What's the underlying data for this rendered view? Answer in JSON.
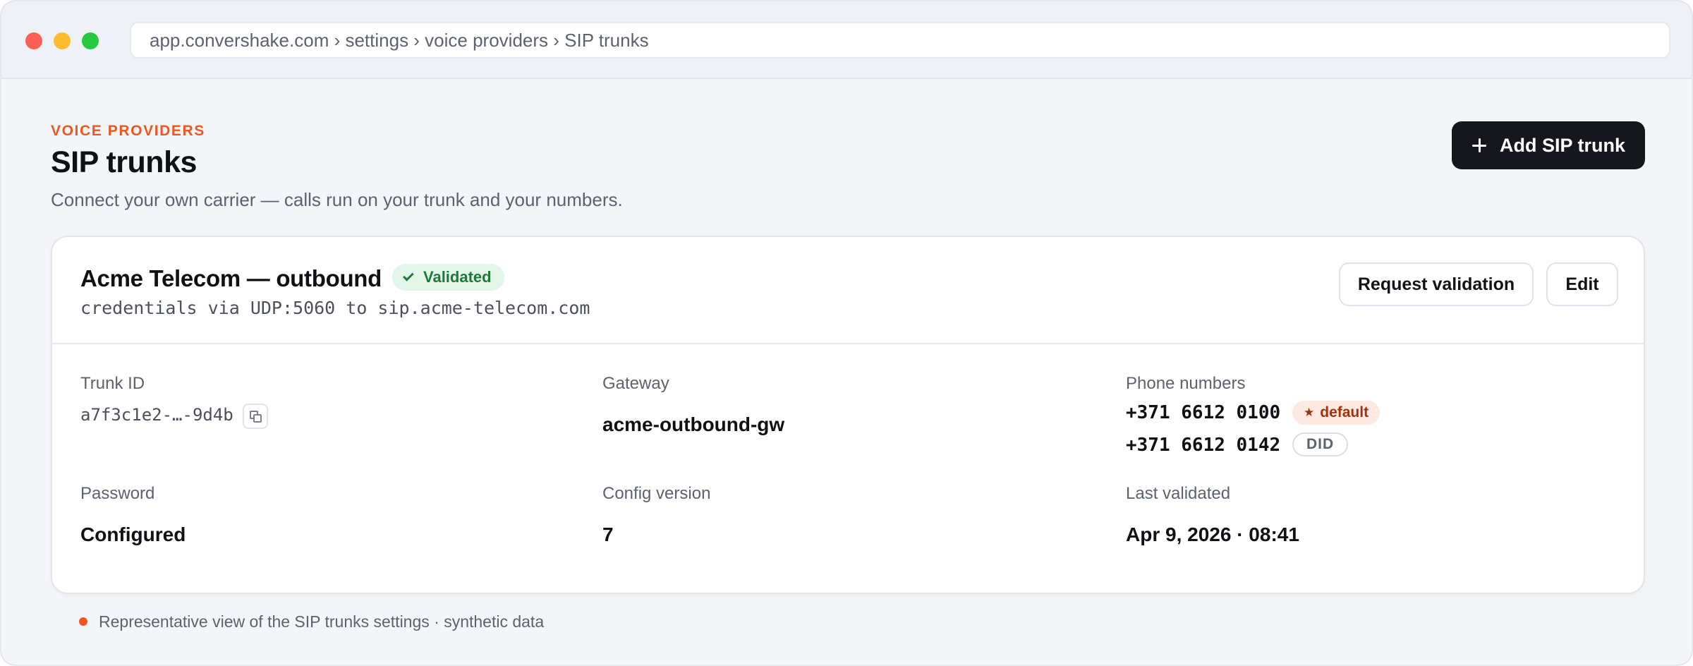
{
  "browser": {
    "address": "app.convershake.com › settings › voice providers › SIP trunks"
  },
  "header": {
    "eyebrow": "VOICE PROVIDERS",
    "title": "SIP trunks",
    "subtitle": "Connect your own carrier — calls run on your trunk and your numbers.",
    "add_button_label": "Add SIP trunk"
  },
  "trunk": {
    "name": "Acme Telecom — outbound",
    "status_badge": "Validated",
    "description": "credentials via UDP:5060 to sip.acme-telecom.com",
    "request_validation_label": "Request validation",
    "edit_label": "Edit",
    "fields": {
      "trunk_id_label": "Trunk ID",
      "trunk_id_value": "a7f3c1e2-…-9d4b",
      "gateway_label": "Gateway",
      "gateway_value": "acme-outbound-gw",
      "phone_numbers_label": "Phone numbers",
      "phone_numbers": [
        {
          "number": "+371 6612 0100",
          "badge": "default"
        },
        {
          "number": "+371 6612 0142",
          "badge": "DID"
        }
      ],
      "password_label": "Password",
      "password_value": "Configured",
      "config_version_label": "Config version",
      "config_version_value": "7",
      "last_validated_label": "Last validated",
      "last_validated_value": "Apr 9, 2026 · 08:41"
    }
  },
  "footnote": "Representative view of the SIP trunks settings · synthetic data",
  "colors": {
    "accent": "#f0561d",
    "primary_button": "#15171c",
    "validated_bg": "#e4f5e9",
    "validated_text": "#1d7a3a",
    "default_badge_bg": "#fde9e1",
    "default_badge_text": "#9a3412"
  }
}
